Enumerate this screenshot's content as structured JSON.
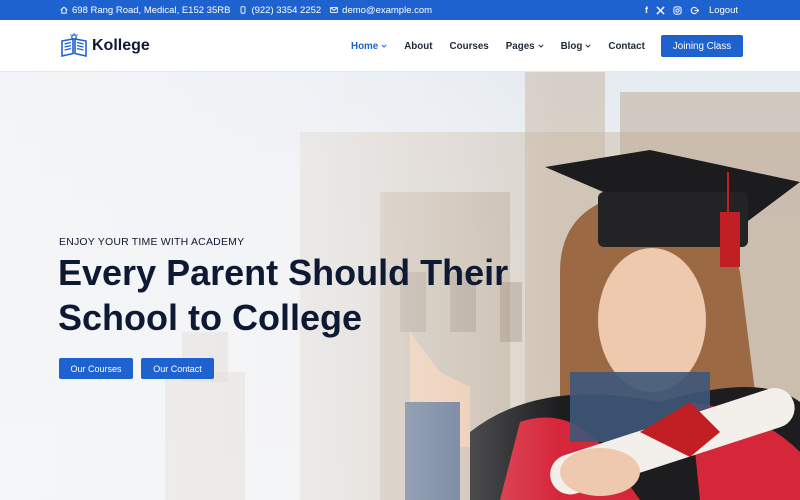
{
  "topbar": {
    "address": "698 Rang Road, Medical, E152 35RB",
    "phone": "(922) 3354 2252",
    "email": "demo@example.com",
    "social": [
      "facebook-icon",
      "x-icon",
      "instagram-icon"
    ],
    "logout": "Logout"
  },
  "header": {
    "brand": "Kollege",
    "nav": [
      {
        "label": "Home",
        "dropdown": true,
        "active": true
      },
      {
        "label": "About",
        "dropdown": false
      },
      {
        "label": "Courses",
        "dropdown": false
      },
      {
        "label": "Pages",
        "dropdown": true
      },
      {
        "label": "Blog",
        "dropdown": true
      },
      {
        "label": "Contact",
        "dropdown": false
      }
    ],
    "cta": "Joining Class"
  },
  "hero": {
    "tagline": "ENJOY YOUR TIME WITH ACADEMY",
    "headline_line1": "Every Parent Should Their",
    "headline_line2": "School to College",
    "btn_courses": "Our Courses",
    "btn_contact": "Our Contact"
  },
  "colors": {
    "primary": "#1e62d0",
    "heading": "#0e1a34"
  }
}
